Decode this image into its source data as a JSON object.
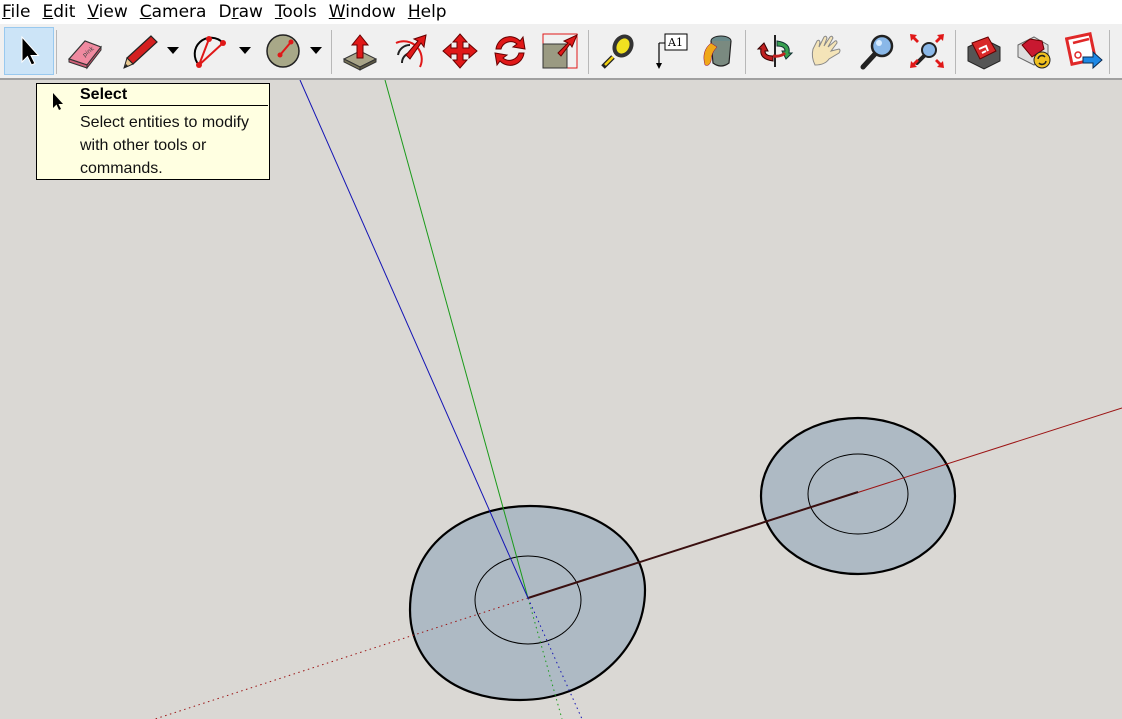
{
  "menubar": {
    "items": [
      {
        "label": "File",
        "accel": "F",
        "rest": "ile"
      },
      {
        "label": "Edit",
        "accel": "E",
        "rest": "dit"
      },
      {
        "label": "View",
        "accel": "V",
        "rest": "iew"
      },
      {
        "label": "Camera",
        "accel": "C",
        "rest": "amera"
      },
      {
        "label": "Draw",
        "pre": "D",
        "accel": "r",
        "rest": "aw"
      },
      {
        "label": "Tools",
        "accel": "T",
        "rest": "ools"
      },
      {
        "label": "Window",
        "accel": "W",
        "rest": "indow"
      },
      {
        "label": "Help",
        "accel": "H",
        "rest": "elp"
      }
    ]
  },
  "toolbar": {
    "tools": [
      {
        "name": "select",
        "icon": "arrow-cursor-icon",
        "active": true
      },
      {
        "name": "eraser",
        "icon": "eraser-icon"
      },
      {
        "name": "line",
        "icon": "pencil-icon",
        "dropdown": true
      },
      {
        "name": "arc",
        "icon": "arc-icon",
        "dropdown": true
      },
      {
        "name": "circle",
        "icon": "circle-icon",
        "dropdown": true
      },
      {
        "name": "push-pull",
        "icon": "push-pull-icon"
      },
      {
        "name": "follow-me",
        "icon": "follow-me-icon"
      },
      {
        "name": "move",
        "icon": "move-icon"
      },
      {
        "name": "rotate",
        "icon": "rotate-icon"
      },
      {
        "name": "scale",
        "icon": "scale-icon"
      },
      {
        "name": "tape-measure",
        "icon": "tape-measure-icon"
      },
      {
        "name": "text",
        "icon": "text-label-icon",
        "label": "A1"
      },
      {
        "name": "paint-bucket",
        "icon": "paint-bucket-icon"
      },
      {
        "name": "orbit",
        "icon": "orbit-icon"
      },
      {
        "name": "pan",
        "icon": "hand-icon"
      },
      {
        "name": "zoom",
        "icon": "magnifier-icon"
      },
      {
        "name": "zoom-extents",
        "icon": "zoom-extents-icon"
      },
      {
        "name": "3d-warehouse",
        "icon": "warehouse-icon"
      },
      {
        "name": "extension-manager",
        "icon": "extension-manager-icon"
      },
      {
        "name": "extension-warehouse",
        "icon": "extension-warehouse-icon"
      }
    ]
  },
  "tooltip": {
    "title": "Select",
    "body_lines": [
      "Select entities to modify",
      "with other tools or",
      "commands."
    ]
  },
  "colors": {
    "canvas_bg": "#dad8d4",
    "face_fill": "#aebac4",
    "axis_red": "#9c1414",
    "axis_green": "#1a9a1a",
    "axis_blue": "#1414b4",
    "selected_bg": "#cce4f7",
    "tooltip_bg": "#ffffe1"
  },
  "scene": {
    "objects": [
      {
        "type": "ring",
        "name": "ring-at-origin"
      },
      {
        "type": "ring",
        "name": "ring-on-red-axis"
      }
    ]
  }
}
